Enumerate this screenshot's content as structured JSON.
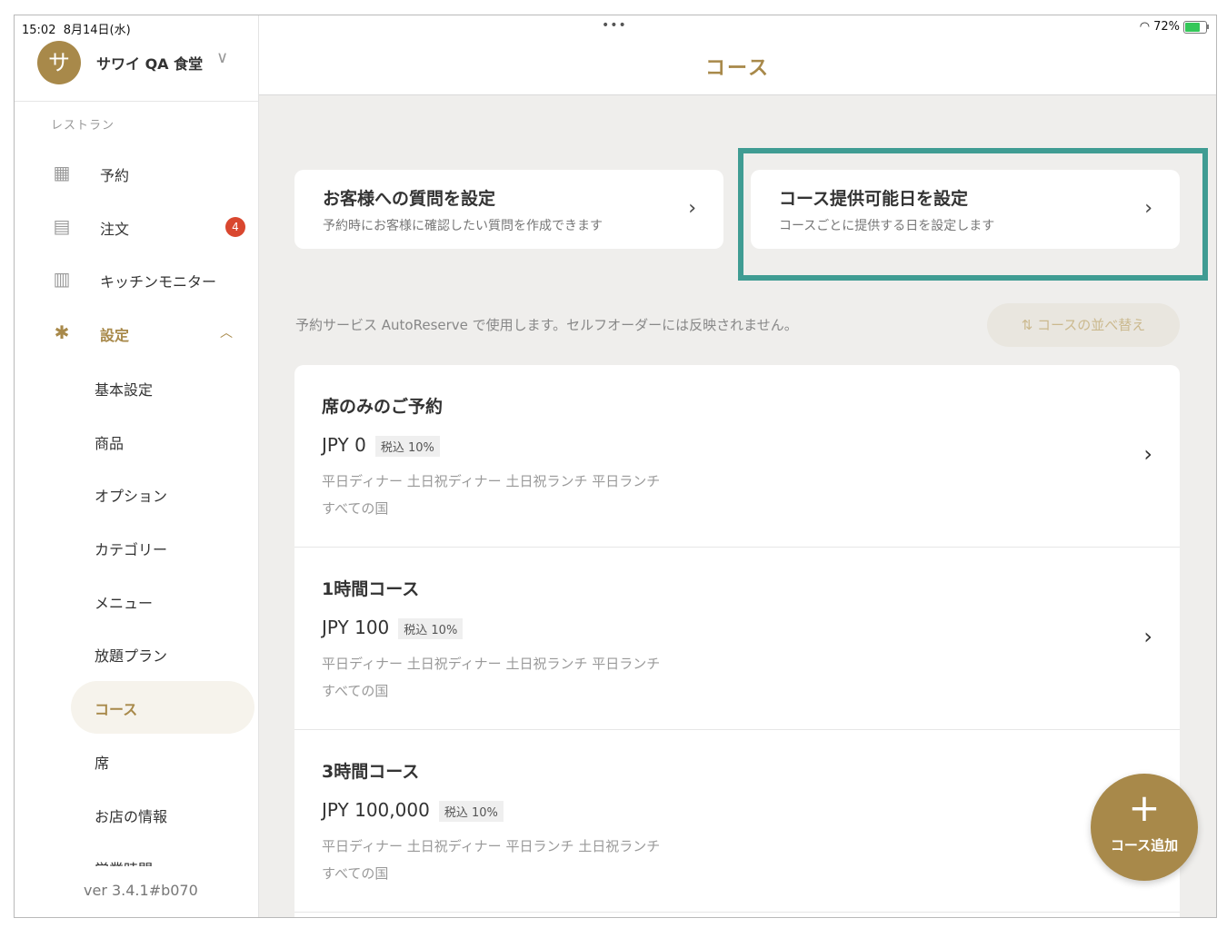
{
  "status": {
    "time": "15:02",
    "date": "8月14日(水)",
    "battery": "72%"
  },
  "store": {
    "initial": "サ",
    "name": "サワイ QA 食堂"
  },
  "sidebar": {
    "section": "レストラン",
    "items": [
      {
        "label": "予約"
      },
      {
        "label": "注文",
        "badge": "4"
      },
      {
        "label": "キッチンモニター"
      },
      {
        "label": "設定"
      }
    ],
    "sub_items": [
      {
        "label": "基本設定"
      },
      {
        "label": "商品"
      },
      {
        "label": "オプション"
      },
      {
        "label": "カテゴリー"
      },
      {
        "label": "メニュー"
      },
      {
        "label": "放題プラン"
      },
      {
        "label": "コース"
      },
      {
        "label": "席"
      },
      {
        "label": "お店の情報"
      },
      {
        "label": "営業時間"
      }
    ],
    "version": "ver 3.4.1#b070"
  },
  "header": {
    "title": "コース"
  },
  "cards": [
    {
      "title": "お客様への質問を設定",
      "subtitle": "予約時にお客様に確認したい質問を作成できます"
    },
    {
      "title": "コース提供可能日を設定",
      "subtitle": "コースごとに提供する日を設定します"
    }
  ],
  "notice": "予約サービス AutoReserve で使用します。セルフオーダーには反映されません。",
  "sort_button": "コースの並べ替え",
  "courses": [
    {
      "name": "席のみのご予約",
      "price": "JPY 0",
      "tax": "税込 10%",
      "tags": "平日ディナー 土日祝ディナー 土日祝ランチ 平日ランチ",
      "country": "すべての国"
    },
    {
      "name": "1時間コース",
      "price": "JPY 100",
      "tax": "税込 10%",
      "tags": "平日ディナー 土日祝ディナー 土日祝ランチ 平日ランチ",
      "country": "すべての国"
    },
    {
      "name": "3時間コース",
      "price": "JPY 100,000",
      "tax": "税込 10%",
      "tags": "平日ディナー 土日祝ディナー 平日ランチ 土日祝ランチ",
      "country": "すべての国"
    }
  ],
  "fab": {
    "label": "コース追加"
  },
  "colors": {
    "accent": "#a8894a",
    "highlight": "#3f9c93",
    "badge": "#d9472f"
  }
}
